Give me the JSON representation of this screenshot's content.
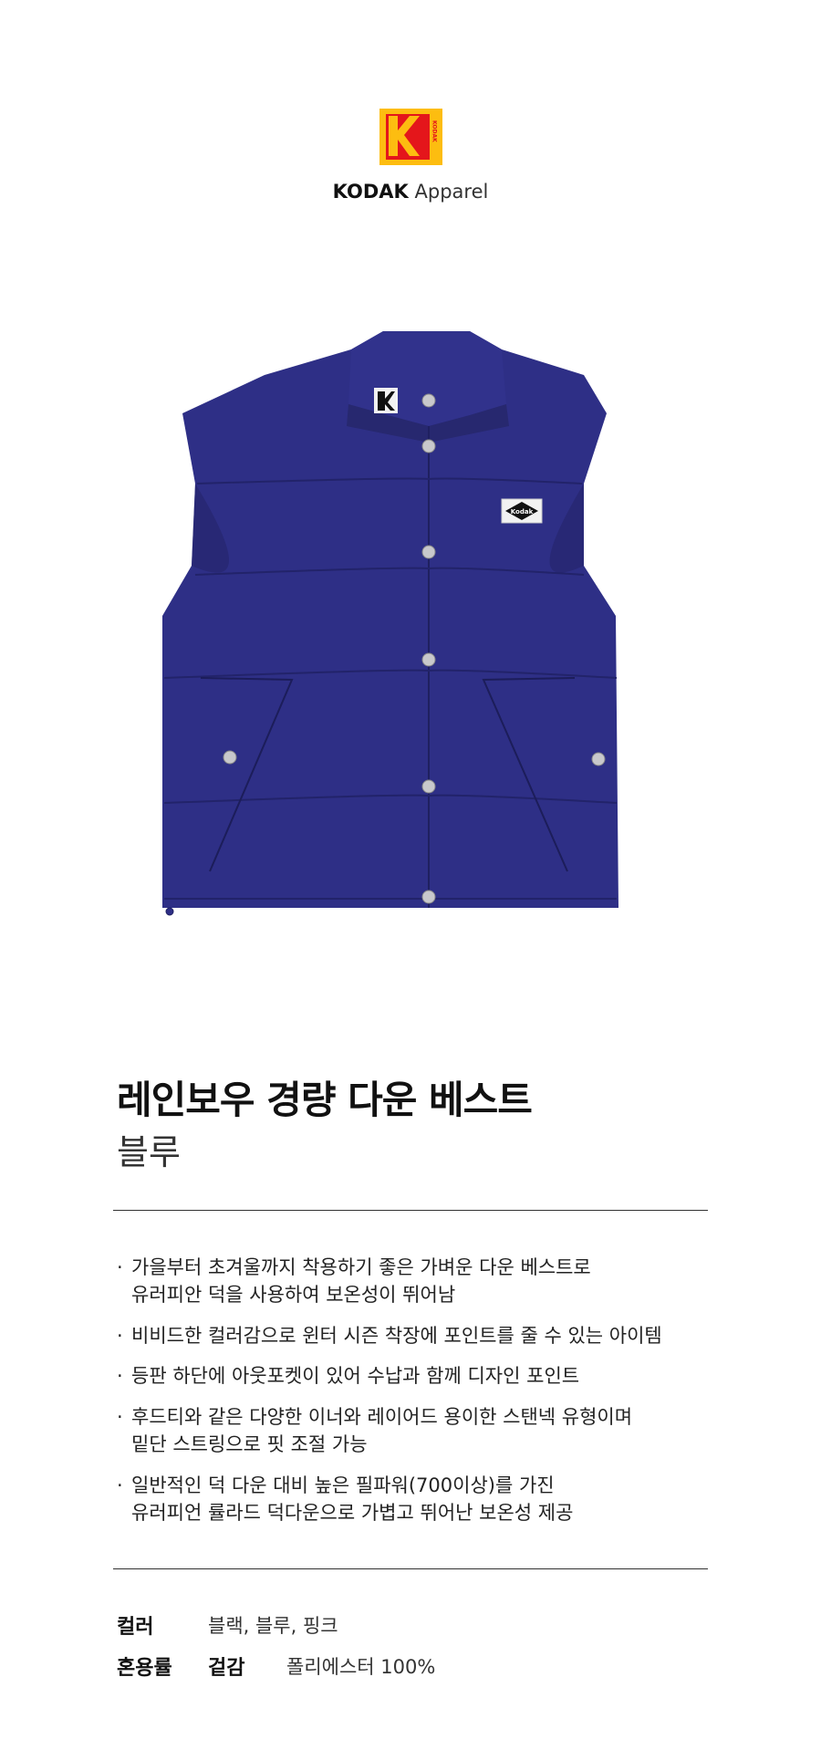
{
  "brand": {
    "logo_icon": "kodak-logo-icon",
    "logo_text": "KODAK",
    "bold": "KODAK",
    "light": "Apparel",
    "colors": {
      "red": "#e4161b",
      "yellow": "#fdbd10"
    }
  },
  "product": {
    "image_icon": "blue-down-vest-image",
    "patch_text": "Kodak",
    "title": "레인보우 경량 다운 베스트",
    "subtitle": "블루",
    "color_hex": "#2e2f86"
  },
  "features": [
    {
      "lines": [
        "가을부터 초겨울까지 착용하기 좋은 가벼운 다운 베스트로",
        "유러피안 덕을 사용하여 보온성이 뛰어남"
      ]
    },
    {
      "lines": [
        "비비드한 컬러감으로 윈터 시즌 착장에 포인트를 줄 수 있는 아이템"
      ]
    },
    {
      "lines": [
        "등판 하단에 아웃포켓이 있어 수납과 함께 디자인 포인트"
      ]
    },
    {
      "lines": [
        "후드티와 같은 다양한 이너와 레이어드 용이한 스탠넥 유형이며",
        "밑단 스트링으로 핏 조절 가능"
      ]
    },
    {
      "lines": [
        "일반적인 덕 다운 대비 높은 필파워(700이상)를 가진",
        "유러피언 률라드 덕다운으로 가볍고 뛰어난 보온성 제공"
      ]
    }
  ],
  "bullet": "·",
  "specs": {
    "color_label": "컬러",
    "color_value": "블랙, 블루, 핑크",
    "blend_label": "혼용률",
    "blend_part": "겉감",
    "blend_value": "폴리에스터 100%"
  }
}
